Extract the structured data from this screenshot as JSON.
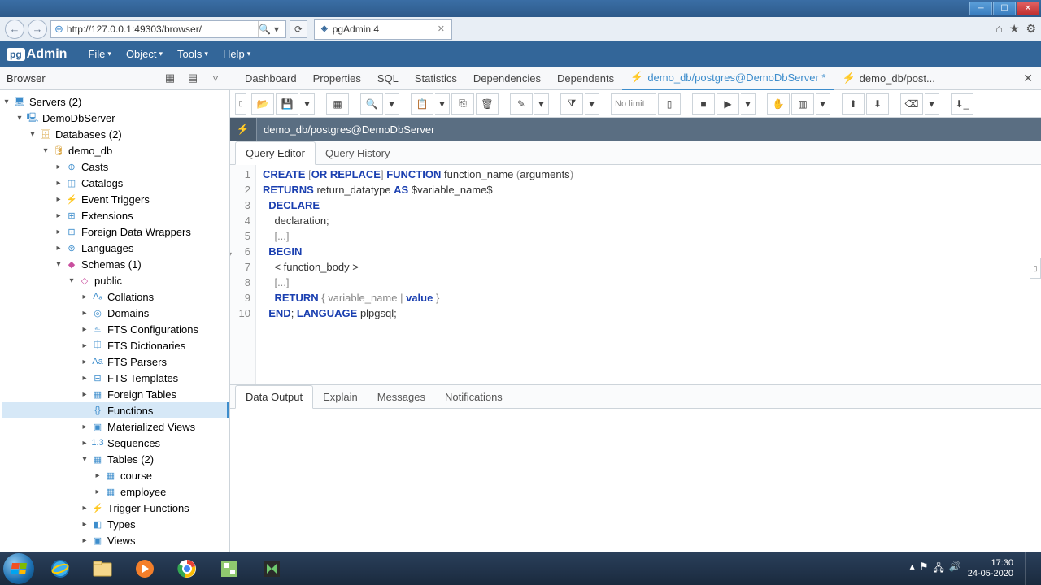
{
  "window": {
    "url": "http://127.0.0.1:49303/browser/",
    "tab_title": "pgAdmin 4"
  },
  "pgadmin": {
    "logo_pg": "pg",
    "logo_admin": "Admin",
    "menu": {
      "file": "File",
      "object": "Object",
      "tools": "Tools",
      "help": "Help"
    }
  },
  "browser_header": "Browser",
  "tree": {
    "servers": "Servers (2)",
    "demodb_server": "DemoDbServer",
    "databases": "Databases (2)",
    "demo_db": "demo_db",
    "casts": "Casts",
    "catalogs": "Catalogs",
    "event_triggers": "Event Triggers",
    "extensions": "Extensions",
    "fdw": "Foreign Data Wrappers",
    "languages": "Languages",
    "schemas": "Schemas (1)",
    "public": "public",
    "collations": "Collations",
    "domains": "Domains",
    "fts_conf": "FTS Configurations",
    "fts_dict": "FTS Dictionaries",
    "fts_parsers": "FTS Parsers",
    "fts_templates": "FTS Templates",
    "foreign_tables": "Foreign Tables",
    "functions": "Functions",
    "mat_views": "Materialized Views",
    "sequences": "Sequences",
    "tables": "Tables (2)",
    "course": "course",
    "employee": "employee",
    "trigger_functions": "Trigger Functions",
    "types": "Types",
    "views": "Views"
  },
  "tabs": {
    "dashboard": "Dashboard",
    "properties": "Properties",
    "sql": "SQL",
    "statistics": "Statistics",
    "dependencies": "Dependencies",
    "dependents": "Dependents",
    "query_active": "demo_db/postgres@DemoDbServer *",
    "query_other": "demo_db/post..."
  },
  "toolbar": {
    "nolimit": "No limit"
  },
  "connection": "demo_db/postgres@DemoDbServer",
  "subtabs": {
    "editor": "Query Editor",
    "history": "Query History"
  },
  "code": {
    "l1a": "CREATE",
    "l1b": "OR REPLACE",
    "l1c": "FUNCTION",
    "l1d": "function_name",
    "l1e": "arguments",
    "l2a": "RETURNS",
    "l2b": "return_datatype",
    "l2c": "AS",
    "l2d": "$variable_name$",
    "l3": "DECLARE",
    "l4": "declaration;",
    "l5": "[...]",
    "l6": "BEGIN",
    "l7": "< function_body >",
    "l8": "[...]",
    "l9a": "RETURN",
    "l9b": "{ variable_name |",
    "l9c": "value",
    "l9d": "}",
    "l10a": "END",
    "l10b": "LANGUAGE",
    "l10c": "plpgsql;"
  },
  "gutter": {
    "1": "1",
    "2": "2",
    "3": "3",
    "4": "4",
    "5": "5",
    "6": "6",
    "7": "7",
    "8": "8",
    "9": "9",
    "10": "10"
  },
  "output_tabs": {
    "data": "Data Output",
    "explain": "Explain",
    "messages": "Messages",
    "notifications": "Notifications"
  },
  "tray": {
    "time": "17:30",
    "date": "24-05-2020"
  }
}
